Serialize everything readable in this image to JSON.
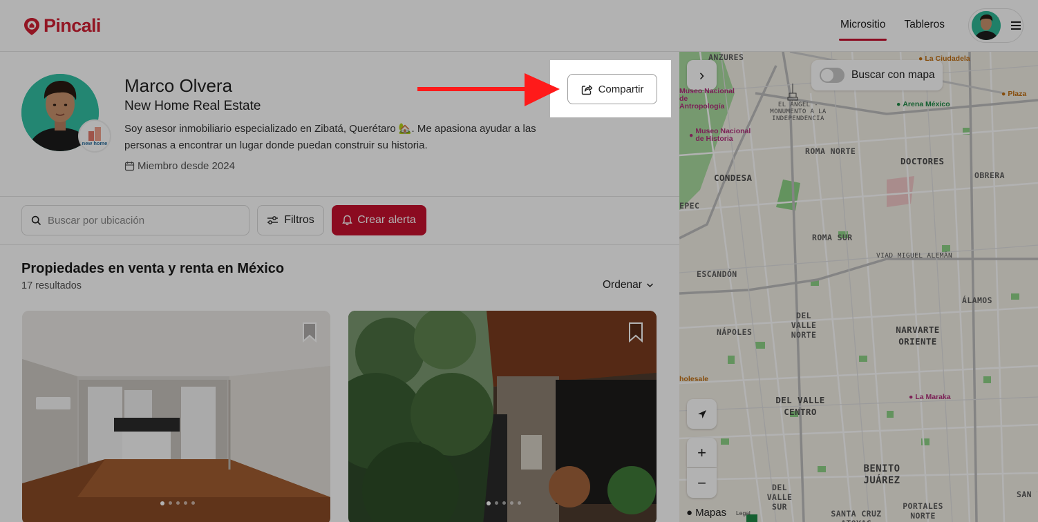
{
  "header": {
    "logo_text": "Pincali",
    "nav": [
      {
        "label": "Micrositio",
        "active": true
      },
      {
        "label": "Tableros",
        "active": false
      }
    ],
    "menu_icon": "hamburger-icon"
  },
  "profile": {
    "name": "Marco Olvera",
    "company": "New Home Real Estate",
    "bio": "Soy asesor inmobiliario especializado en Zibatá, Querétaro 🏡. Me apasiona ayudar a las personas a encontrar un lugar donde puedan construir su historia.",
    "member_since": "Miembro desde 2024",
    "brand_badge_text": "new home",
    "share_label": "Compartir"
  },
  "search": {
    "placeholder": "Buscar por ubicación",
    "filters_label": "Filtros",
    "alert_label": "Crear alerta"
  },
  "results": {
    "title": "Propiedades en venta y renta en México",
    "count": "17 resultados",
    "sort_label": "Ordenar"
  },
  "map": {
    "toggle_label": "Buscar con mapa",
    "attribution": "Mapas",
    "legal": "Legal",
    "zoom_in": "+",
    "zoom_out": "−",
    "expand": "›",
    "neighborhoods": [
      {
        "id": "anzures",
        "name": "ANZURES"
      },
      {
        "id": "angel",
        "name": "EL ÁNGEL - MONUMENTO A LA INDEPENDENCIA"
      },
      {
        "id": "roma-norte",
        "name": "ROMA NORTE"
      },
      {
        "id": "doctores",
        "name": "DOCTORES"
      },
      {
        "id": "obrera",
        "name": "OBRERA"
      },
      {
        "id": "condesa",
        "name": "CONDESA"
      },
      {
        "id": "roma-sur",
        "name": "ROMA SUR"
      },
      {
        "id": "viaducto",
        "name": "VIAD MIGUEL ALEMÁN"
      },
      {
        "id": "escandon",
        "name": "ESCANDÓN"
      },
      {
        "id": "alamos",
        "name": "ÁLAMOS"
      },
      {
        "id": "del-valle-norte",
        "name": "DEL VALLE NORTE"
      },
      {
        "id": "napoles",
        "name": "NÁPOLES"
      },
      {
        "id": "narvarte",
        "name": "NARVARTE ORIENTE"
      },
      {
        "id": "del-valle-centro",
        "name": "DEL VALLE CENTRO"
      },
      {
        "id": "benito-juarez",
        "name": "BENITO JUÁREZ"
      },
      {
        "id": "del-valle-sur",
        "name": "DEL VALLE SUR"
      },
      {
        "id": "santa-cruz",
        "name": "SANTA CRUZ ATOYAC"
      },
      {
        "id": "portales",
        "name": "PORTALES NORTE"
      },
      {
        "id": "epec",
        "name": "EPEC"
      },
      {
        "id": "san-te",
        "name": "SAN TE"
      }
    ],
    "pois": [
      {
        "id": "ciudadela",
        "name": "La Ciudadela"
      },
      {
        "id": "antropologia",
        "name": "Museo Nacional de Antropología"
      },
      {
        "id": "arena",
        "name": "Arena México"
      },
      {
        "id": "plaza",
        "name": "Plaza"
      },
      {
        "id": "historia",
        "name": "Museo Nacional de Historia"
      },
      {
        "id": "maraka",
        "name": "La Maraka"
      },
      {
        "id": "wholesale",
        "name": "holesale"
      }
    ]
  },
  "colors": {
    "brand": "#d21f33",
    "alert_button": "#c8102e",
    "park_green": "#7fcf7a",
    "overlay": "rgba(0,0,0,0.30)"
  }
}
